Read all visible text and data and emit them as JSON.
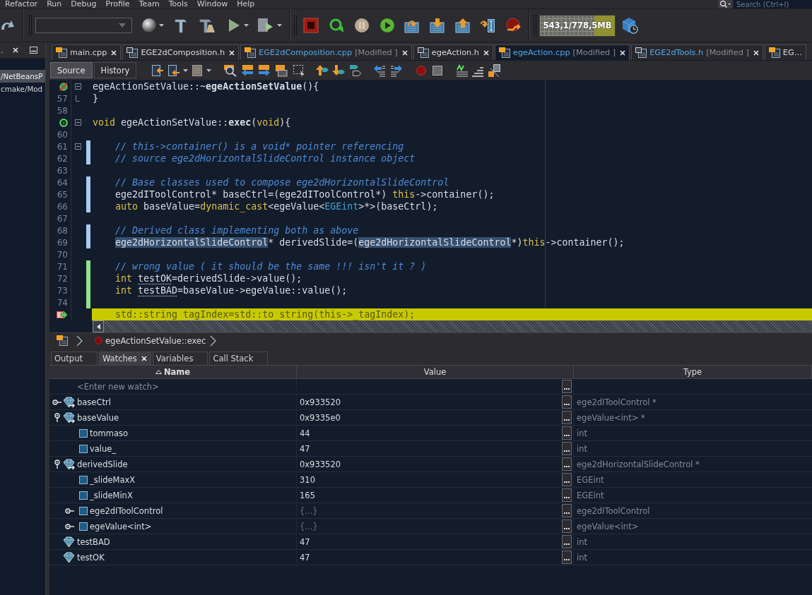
{
  "menu_bar": {
    "items": [
      "Refactor",
      "Run",
      "Debug",
      "Profile",
      "Team",
      "Tools",
      "Window",
      "Help"
    ],
    "search": {
      "placeholder": "Search (Ctrl+I)"
    }
  },
  "toolbar": {
    "memory_meter": {
      "reading": "543,1/778,5MB"
    }
  },
  "sidebar": {
    "title": ".",
    "items": [
      {
        "label": "/NetBeansP",
        "selected": true
      },
      {
        "label": "cmake/Mod",
        "selected": false
      }
    ]
  },
  "editor": {
    "tabs": [
      {
        "label": "main.cpp",
        "kind": "cpp",
        "selected": false,
        "close_button": true
      },
      {
        "label": "EGE2dComposition.h",
        "kind": "header",
        "selected": false,
        "close_button": true
      },
      {
        "label": "EGE2dComposition.cpp",
        "note": "[Modified ]",
        "kind": "cpp",
        "selected": false,
        "close_button": true
      },
      {
        "label": "egeAction.h",
        "kind": "header",
        "selected": false,
        "close_button": true
      },
      {
        "label": "egeAction.cpp",
        "note": "[Modified ]",
        "kind": "cpp",
        "selected": true,
        "close_button": true
      },
      {
        "label": "EGE2dTools.h",
        "note": "[Modified ]",
        "kind": "header",
        "selected": false,
        "close_button": true
      },
      {
        "label": "EG…",
        "kind": "cpp",
        "selected": false,
        "close_button": false
      }
    ],
    "view_tabs": [
      {
        "label": "Source",
        "selected": true
      },
      {
        "label": "History",
        "selected": false
      }
    ],
    "code_lines": [
      {
        "gutter_icon": {
          "kind": "slashed-circle"
        },
        "fold": {
          "kind": "start"
        },
        "current": false,
        "tokens": [
          {
            "kind": "plain",
            "text": "egeActionSetValue::~"
          },
          {
            "kind": "bold",
            "text": "egeActionSetValue"
          },
          {
            "kind": "plain",
            "text": "(){"
          }
        ]
      },
      {
        "number": "57",
        "fold": {
          "kind": "end"
        },
        "current": false,
        "tokens": [
          {
            "kind": "plain",
            "text": "}"
          }
        ]
      },
      {
        "number": "58",
        "current": false
      },
      {
        "gutter_icon": {
          "kind": "ring"
        },
        "fold": {
          "kind": "start"
        },
        "current": false,
        "tokens": [
          {
            "kind": "keyword",
            "text": "void"
          },
          {
            "kind": "plain",
            "text": " egeActionSetValue::"
          },
          {
            "kind": "bold",
            "text": "exec"
          },
          {
            "kind": "plain",
            "text": "("
          },
          {
            "kind": "keyword",
            "text": "void"
          },
          {
            "kind": "plain",
            "text": "){"
          }
        ]
      },
      {
        "number": "60",
        "current": false
      },
      {
        "number": "61",
        "fold": {
          "kind": "start"
        },
        "change": {
          "kind": "modified"
        },
        "current": false,
        "tokens": [
          {
            "kind": "comment",
            "text": "    // this->container() is a void* pointer referencing"
          }
        ]
      },
      {
        "number": "62",
        "change": {
          "kind": "modified"
        },
        "current": false,
        "tokens": [
          {
            "kind": "comment",
            "text": "    // source ege2dHorizontalSlideControl instance object"
          }
        ]
      },
      {
        "number": "63",
        "current": false
      },
      {
        "number": "64",
        "change": {
          "kind": "modified"
        },
        "current": false,
        "tokens": [
          {
            "kind": "comment",
            "text": "    // Base classes used to compose ege2dHorizontalSlideControl"
          }
        ]
      },
      {
        "number": "65",
        "change": {
          "kind": "modified"
        },
        "current": false,
        "tokens": [
          {
            "kind": "plain",
            "text": "    ege2dIToolControl* baseCtrl=(ege2dIToolControl*) "
          },
          {
            "kind": "keyword",
            "text": "this"
          },
          {
            "kind": "plain",
            "text": "->container();"
          }
        ]
      },
      {
        "number": "66",
        "change": {
          "kind": "modified"
        },
        "current": false,
        "tokens": [
          {
            "kind": "keyword",
            "text": "    auto"
          },
          {
            "kind": "plain",
            "text": " baseValue="
          },
          {
            "kind": "keyword",
            "text": "dynamic_cast"
          },
          {
            "kind": "plain",
            "text": "<egeValue<"
          },
          {
            "kind": "type",
            "text": "EGEint"
          },
          {
            "kind": "plain",
            "text": ">*>(baseCtrl);"
          }
        ]
      },
      {
        "number": "67",
        "current": false
      },
      {
        "number": "68",
        "change": {
          "kind": "modified"
        },
        "current": false,
        "tokens": [
          {
            "kind": "comment",
            "text": "    // Derived class implementing both as above"
          }
        ]
      },
      {
        "number": "69",
        "change": {
          "kind": "modified"
        },
        "current": false,
        "tokens": [
          {
            "kind": "selection",
            "text": "    ege2dHorizontalSlideControl"
          },
          {
            "kind": "plain",
            "text": "* derivedSlide=("
          },
          {
            "kind": "selection",
            "text": "ege2dHorizontalSlideControl"
          },
          {
            "kind": "plain",
            "text": "*)"
          },
          {
            "kind": "keyword",
            "text": "this"
          },
          {
            "kind": "plain",
            "text": "->container();"
          }
        ]
      },
      {
        "number": "70",
        "current": false
      },
      {
        "number": "71",
        "change": {
          "kind": "added"
        },
        "current": false,
        "tokens": [
          {
            "kind": "comment",
            "text": "    // wrong value ( it should be the same !!! isn't it ? )"
          }
        ]
      },
      {
        "number": "72",
        "change": {
          "kind": "added"
        },
        "current": false,
        "tokens": [
          {
            "kind": "keyword",
            "text": "    int "
          },
          {
            "kind": "unused",
            "text": "testOK"
          },
          {
            "kind": "plain",
            "text": "=derivedSlide->value();"
          }
        ]
      },
      {
        "number": "73",
        "change": {
          "kind": "added"
        },
        "current": false,
        "tokens": [
          {
            "kind": "keyword",
            "text": "    int "
          },
          {
            "kind": "unused",
            "text": "testBAD"
          },
          {
            "kind": "plain",
            "text": "=baseValue->egeValue::value();"
          }
        ]
      },
      {
        "number": "74",
        "change": {
          "kind": "added"
        },
        "current": false
      },
      {
        "gutter_icon": {
          "kind": "pc-arrow"
        },
        "current": true,
        "tokens": [
          {
            "kind": "plain",
            "text": "    std::string "
          },
          {
            "kind": "unused",
            "text": "tagIndex"
          },
          {
            "kind": "plain",
            "text": "=std::to_string(this->_tagIndex);"
          }
        ]
      }
    ],
    "breadcrumb": [
      "egeActionSetValue::exec"
    ]
  },
  "output_panel": {
    "tabs": [
      {
        "label": "Output",
        "selected": false
      },
      {
        "label": "Watches",
        "selected": true
      },
      {
        "label": "Variables",
        "selected": false
      },
      {
        "label": "Call Stack",
        "selected": false
      }
    ],
    "watches": {
      "columns": [
        {
          "label": "Name",
          "sort": {
            "kind": "ascending"
          }
        },
        {
          "label": "Value"
        },
        {
          "label": "Type"
        }
      ],
      "new_watch": {
        "placeholder": "<Enter new watch>"
      },
      "rows": [
        {
          "name": "baseCtrl",
          "value": "0x933520",
          "type": "ege2dIToolControl *",
          "kind": "pointer",
          "expanded": false,
          "value_dimmed": false
        },
        {
          "name": "baseValue",
          "value": "0x9335e0",
          "type": "egeValue<int> *",
          "kind": "pointer",
          "expanded": true,
          "value_dimmed": false,
          "children": [
            {
              "name": "tommaso",
              "value": "44",
              "type": "int",
              "kind": "field",
              "value_dimmed": false
            },
            {
              "name": "value_",
              "value": "47",
              "type": "int",
              "kind": "field",
              "value_dimmed": false
            }
          ]
        },
        {
          "name": "derivedSlide",
          "value": "0x933520",
          "type": "ege2dHorizontalSlideControl *",
          "kind": "pointer",
          "expanded": true,
          "value_dimmed": false,
          "children": [
            {
              "name": "_slideMaxX",
              "value": "310",
              "type": "EGEint",
              "kind": "field",
              "value_dimmed": false
            },
            {
              "name": "_slideMinX",
              "value": "165",
              "type": "EGEint",
              "kind": "field",
              "value_dimmed": false
            },
            {
              "name": "ege2dIToolControl",
              "value": "{...}",
              "type": "ege2dIToolControl",
              "kind": "field",
              "expanded": false,
              "value_dimmed": true
            },
            {
              "name": "egeValue<int>",
              "value": "{...}",
              "type": "egeValue<int>",
              "kind": "field",
              "expanded": false,
              "value_dimmed": true
            }
          ]
        },
        {
          "name": "testBAD",
          "value": "47",
          "type": "int",
          "kind": "variable",
          "value_dimmed": false
        },
        {
          "name": "testOK",
          "value": "47",
          "type": "int",
          "kind": "variable",
          "value_dimmed": false
        }
      ]
    }
  }
}
